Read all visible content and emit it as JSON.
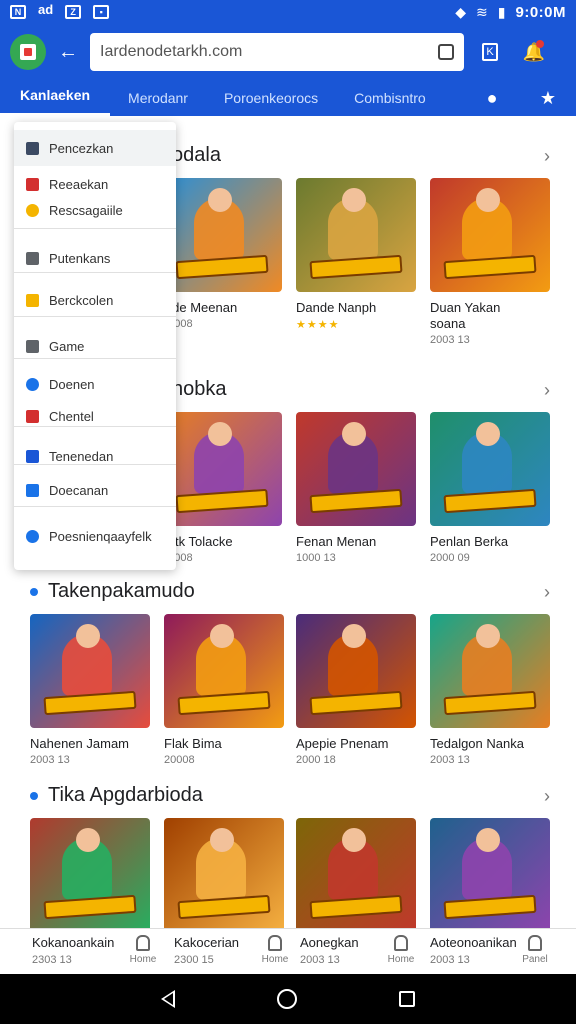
{
  "status_bar": {
    "left_icons": [
      "N",
      "ad",
      "Z",
      "▪"
    ],
    "time": "9:0:0M"
  },
  "toolbar": {
    "search_text": "Iardenodetarkh.com",
    "icons": [
      "app-icon",
      "back-arrow-icon",
      "search-icon",
      "k-box-icon",
      "bell-icon"
    ]
  },
  "tabs": {
    "items": [
      "Kanlaeken",
      "Merodanr",
      "Poroenkeorocs",
      "Combisntro"
    ],
    "active": 0
  },
  "menu": {
    "items": [
      {
        "label": "Pencezkan",
        "icon_color": "#3c4a63"
      },
      {
        "label": "Reeaekan",
        "icon_color": "#d32f2f"
      },
      {
        "label": "Rescsagaiile",
        "icon_color": "#f4b400"
      },
      {
        "label": "Putenkans",
        "icon_color": "#5f6368"
      },
      {
        "label": "Berckcolen",
        "icon_color": "#f4b400"
      },
      {
        "label": "Game",
        "icon_color": "#5f6368"
      },
      {
        "label": "Doenen",
        "icon_color": "#1a73e8"
      },
      {
        "label": "Chentel",
        "icon_color": "#d32f2f"
      },
      {
        "label": "Tenenedan",
        "icon_color": "#1a56d6"
      },
      {
        "label": "Doecanan",
        "icon_color": "#1a73e8"
      },
      {
        "label": "Poesnienqaayfelk",
        "icon_color": "#1a73e8"
      }
    ]
  },
  "sections": [
    {
      "title": "odala",
      "cards": [
        {
          "name": "hide Meenan",
          "meta": "10008",
          "stars": "",
          "c1": "#2b8fd6",
          "c2": "#f08a24"
        },
        {
          "name": "Dande Nanph",
          "meta": "",
          "stars": "★★★★",
          "c1": "#6b7a2f",
          "c2": "#d9a441"
        },
        {
          "name": "Duan Yakan",
          "meta": "2003 13",
          "sub": "soana",
          "stars": "",
          "c1": "#c0392b",
          "c2": "#f39c12"
        }
      ]
    },
    {
      "title": "nobka",
      "cards": [
        {
          "name": "laitk Tolacke",
          "meta": "10008",
          "stars": "",
          "c1": "#e67e22",
          "c2": "#8e44ad"
        },
        {
          "name": "Fenan Menan",
          "meta": "1000 13",
          "stars": "",
          "c1": "#c0392b",
          "c2": "#6c3483"
        },
        {
          "name": "Penlan Berka",
          "meta": "2000 09",
          "stars": "",
          "c1": "#1f8f6a",
          "c2": "#2e86c1"
        }
      ]
    },
    {
      "title": "Takenpakamudo",
      "cards": [
        {
          "name": "Nahenen Jamam",
          "meta": "2003 13",
          "stars": "",
          "c1": "#1565c0",
          "c2": "#e74c3c"
        },
        {
          "name": "Flak Bima",
          "meta": "20008",
          "stars": "",
          "c1": "#8e1a5a",
          "c2": "#f39c12"
        },
        {
          "name": "Apepie Pnenam",
          "meta": "2000 18",
          "stars": "",
          "c1": "#4a2c7a",
          "c2": "#d35400"
        },
        {
          "name": "Tedalgon Nanka",
          "meta": "2003 13",
          "stars": "",
          "c1": "#17a589",
          "c2": "#e67e22"
        }
      ]
    },
    {
      "title": "Tika Apgdarbioda",
      "cards": [
        {
          "name": "Kokanoankain",
          "meta": "2303 13",
          "stars": "",
          "c1": "#b03a2e",
          "c2": "#27ae60"
        },
        {
          "name": "Kakocerian",
          "meta": "2300 15",
          "stars": "",
          "c1": "#a04000",
          "c2": "#f5b041"
        },
        {
          "name": "Aonegkan",
          "meta": "2003 13",
          "stars": "",
          "c1": "#7d6608",
          "c2": "#c0392b"
        },
        {
          "name": "Aoteonoanikan",
          "meta": "2003 13",
          "stars": "",
          "c1": "#1f618d",
          "c2": "#8e44ad"
        }
      ]
    }
  ],
  "bottom_nav": {
    "items": [
      {
        "label": "Kokanoankain",
        "sub": "2303 13"
      },
      {
        "label": "Kakocerian",
        "sub": "2300 15"
      },
      {
        "label": "Aonegkan",
        "sub": "2003 13"
      },
      {
        "label": "Aoteonoanikan",
        "sub": "2003 13"
      }
    ],
    "icons": [
      "Home",
      "Home",
      "Home",
      "Panel"
    ]
  }
}
